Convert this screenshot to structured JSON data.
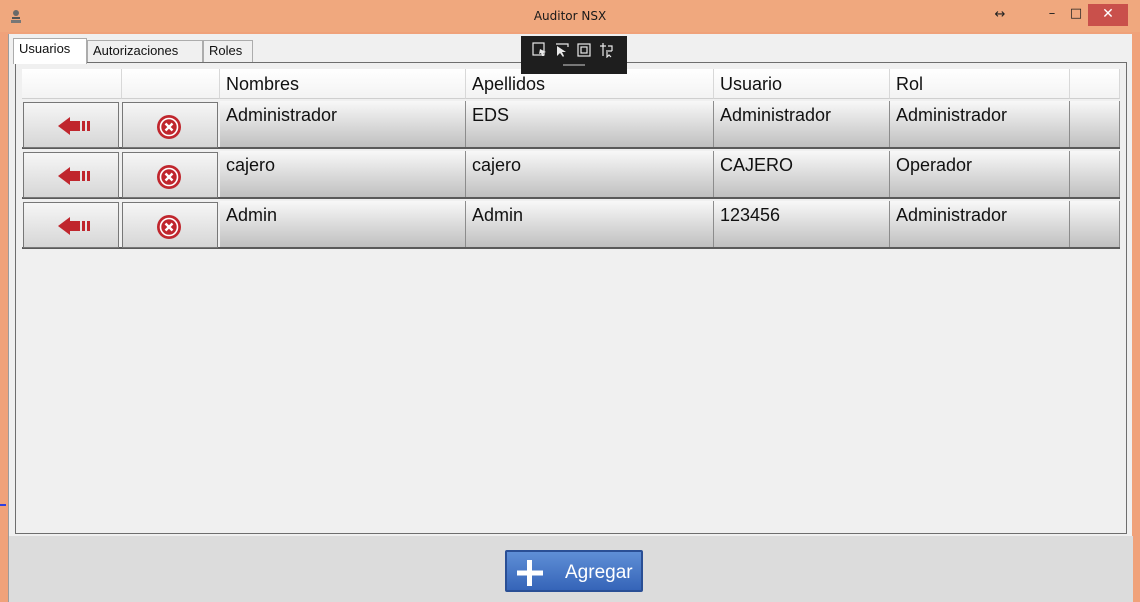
{
  "window": {
    "title": "Auditor NSX",
    "close_glyph": "✕",
    "minimize_glyph": "–",
    "maximize_glyph": "□",
    "resize_glyph": "↔"
  },
  "tabs": [
    {
      "label": "Usuarios",
      "active": true
    },
    {
      "label": "Autorizaciones",
      "active": false
    },
    {
      "label": "Roles",
      "active": false
    }
  ],
  "debug_toolbar": {
    "icons": [
      "select-element-icon",
      "inspect-pointer-icon",
      "frame-icon",
      "layout-adorner-icon"
    ]
  },
  "grid": {
    "columns": [
      "",
      "",
      "Nombres",
      "Apellidos",
      "Usuario",
      "Rol"
    ],
    "rows": [
      {
        "nombres": "Administrador",
        "apellidos": "EDS",
        "usuario": "Administrador",
        "rol": "Administrador"
      },
      {
        "nombres": "cajero",
        "apellidos": "cajero",
        "usuario": "CAJERO",
        "rol": "Operador"
      },
      {
        "nombres": "Admin",
        "apellidos": "Admin",
        "usuario": "123456",
        "rol": "Administrador"
      }
    ]
  },
  "footer": {
    "add_label": "Agregar"
  },
  "colors": {
    "titlebar": "#f0a87e",
    "accent_red": "#c0262d",
    "button_blue": "#3f6fc4",
    "close_red": "#c9504b"
  }
}
